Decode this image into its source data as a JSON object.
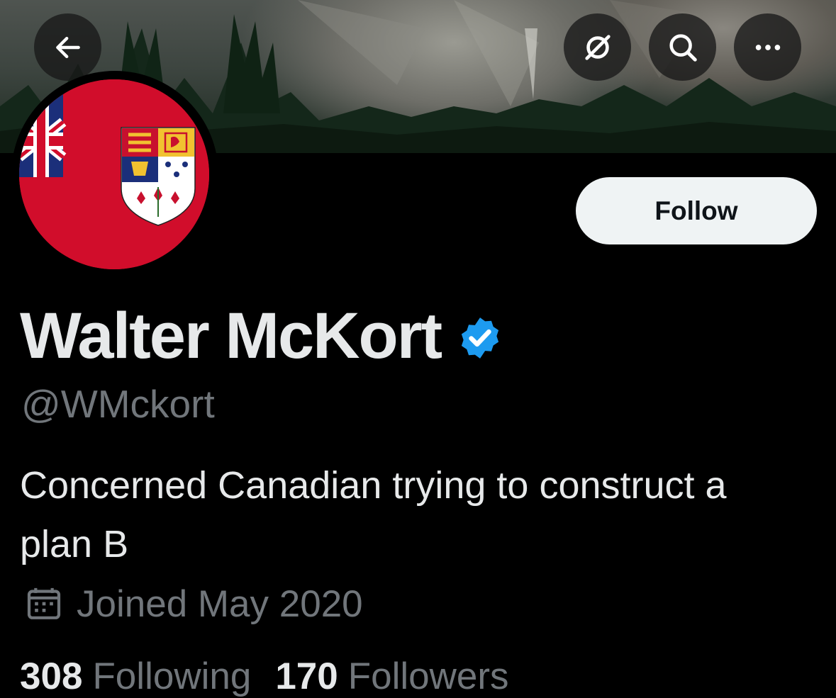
{
  "header": {
    "back_icon": "arrow-left-icon",
    "grok_icon": "grok-icon",
    "search_icon": "search-icon",
    "more_icon": "more-horizontal-icon"
  },
  "profile": {
    "display_name": "Walter McKort",
    "handle": "@WMckort",
    "verified": true,
    "verified_color": "#1d9bf0",
    "follow_label": "Follow",
    "bio": "Concerned Canadian trying to construct a plan B",
    "joined": "Joined May 2020",
    "joined_icon": "calendar-icon",
    "following_count": "308",
    "following_label": "Following",
    "followers_count": "170",
    "followers_label": "Followers"
  },
  "colors": {
    "background": "#000000",
    "text_primary": "#e7e9ea",
    "text_secondary": "#71767b",
    "follow_button_bg": "#eff3f4",
    "avatar_red": "#d10d2b"
  }
}
